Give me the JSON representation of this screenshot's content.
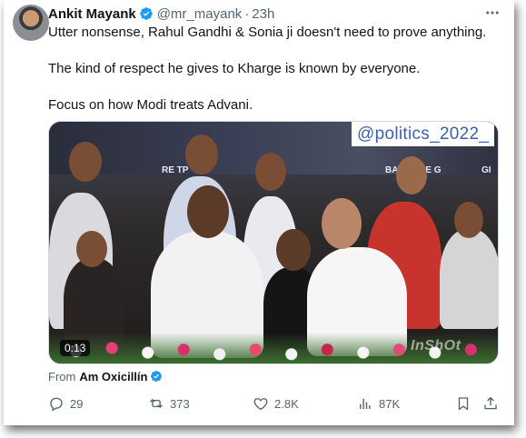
{
  "tweet": {
    "author_name": "Ankit Mayank",
    "handle": "@mr_mayank",
    "separator": "·",
    "time": "23h",
    "paragraphs": [
      "Utter nonsense, Rahul Gandhi & Sonia ji doesn't need to prove anything.",
      "The kind of respect he gives to Kharge is known by everyone.",
      "Focus on how Modi treats Advani."
    ]
  },
  "media": {
    "watermark": "@politics_2022_",
    "app_watermark": "InShOt",
    "duration": "0:13",
    "banner_texts": [
      "RE TP",
      "BAVIKERE G",
      "GI"
    ]
  },
  "from": {
    "label": "From",
    "source": "Am Oxicillín"
  },
  "actions": {
    "replies": "29",
    "reposts": "373",
    "likes": "2.8K",
    "views": "87K"
  },
  "icons": [
    "avatar",
    "verified-badge-icon",
    "more-icon",
    "reply-icon",
    "repost-icon",
    "like-icon",
    "views-icon",
    "bookmark-icon",
    "share-icon"
  ],
  "colors": {
    "text_primary": "#0f1419",
    "text_secondary": "#536471",
    "verified_blue": "#1d9bf0",
    "watermark_blue": "#3b5fb5"
  }
}
